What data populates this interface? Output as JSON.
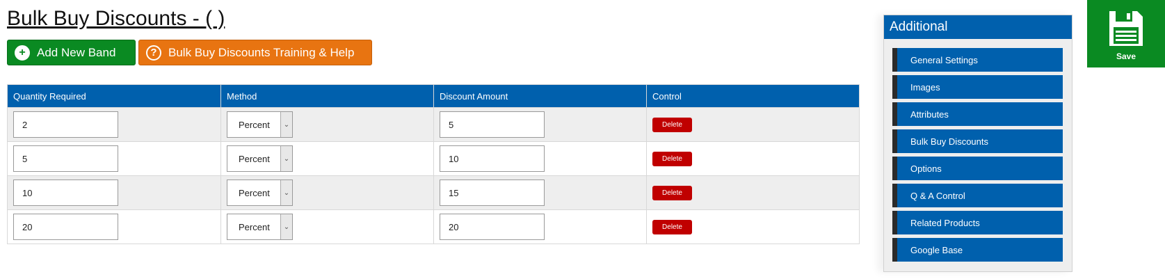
{
  "page": {
    "title": "Bulk Buy Discounts - ( )"
  },
  "toolbar": {
    "add_band_label": "Add New Band",
    "help_label": "Bulk Buy Discounts Training & Help"
  },
  "table": {
    "headers": [
      "Quantity Required",
      "Method",
      "Discount Amount",
      "Control"
    ],
    "rows": [
      {
        "quantity": "2",
        "method": "Percent",
        "discount": "5",
        "control": "Delete"
      },
      {
        "quantity": "5",
        "method": "Percent",
        "discount": "10",
        "control": "Delete"
      },
      {
        "quantity": "10",
        "method": "Percent",
        "discount": "15",
        "control": "Delete"
      },
      {
        "quantity": "20",
        "method": "Percent",
        "discount": "20",
        "control": "Delete"
      }
    ]
  },
  "sidebar": {
    "title": "Additional",
    "items": [
      {
        "label": "General Settings"
      },
      {
        "label": "Images"
      },
      {
        "label": "Attributes"
      },
      {
        "label": "Bulk Buy Discounts"
      },
      {
        "label": "Options"
      },
      {
        "label": "Q & A Control"
      },
      {
        "label": "Related Products"
      },
      {
        "label": "Google Base"
      }
    ]
  },
  "save": {
    "label": "Save",
    "icon": "floppy-disk-icon"
  },
  "icons": {
    "add": "plus-circle-icon",
    "help": "question-circle-icon",
    "dropdown": "chevron-down-icon"
  },
  "colors": {
    "primary_blue": "#0060ad",
    "green": "#0a8a22",
    "orange": "#e87411",
    "delete_red": "#c00000"
  }
}
